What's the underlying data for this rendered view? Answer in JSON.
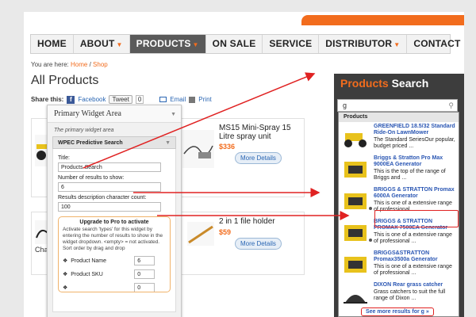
{
  "nav": {
    "items": [
      {
        "label": "HOME",
        "caret": false,
        "active": false
      },
      {
        "label": "ABOUT",
        "caret": true,
        "active": false
      },
      {
        "label": "PRODUCTS",
        "caret": true,
        "active": true
      },
      {
        "label": "ON SALE",
        "caret": false,
        "active": false
      },
      {
        "label": "SERVICE",
        "caret": false,
        "active": false
      },
      {
        "label": "DISTRIBUTOR",
        "caret": true,
        "active": false
      },
      {
        "label": "CONTACT",
        "caret": false,
        "active": false
      }
    ]
  },
  "breadcrumb": {
    "prefix": "You are here:",
    "home": "Home",
    "sep": "/",
    "current": "Shop"
  },
  "page_title": "All Products",
  "share": {
    "label": "Share this:",
    "facebook": "Facebook",
    "tweet": "Tweet",
    "tweet_count": "0",
    "email": "Email",
    "print": "Print"
  },
  "products": [
    {
      "name": "MS15 Mini-Spray 15 Litre spray unit",
      "price": "$336",
      "more": "More Details"
    },
    {
      "name": "2 in 1 file holder",
      "price": "$59",
      "more": "More Details"
    }
  ],
  "clipped_product_label": "Cha",
  "widget": {
    "area_title": "Primary Widget Area",
    "area_desc": "The primary widget area",
    "name": "WPEC Predictive Search",
    "title_label": "Title:",
    "title_value": "Products Search",
    "results_label": "Number of results to show:",
    "results_value": "6",
    "desc_label": "Results description character count:",
    "desc_value": "100",
    "upgrade_title": "Upgrade to Pro to activate",
    "upgrade_desc": "Activate search 'types' for this widget by entering the number of results to show in the widget dropdown. <empty> = not activated. Sort order by drag and drop",
    "options": [
      {
        "name": "Product Name",
        "value": "6"
      },
      {
        "name": "Product SKU",
        "value": "0"
      },
      {
        "name": "",
        "value": "0"
      }
    ]
  },
  "sidebar": {
    "title_orange": "Products",
    "title_white": "Search",
    "search_value": "g",
    "dropdown_header": "Products",
    "results": [
      {
        "name": "GREENFIELD 18.5/32 Standard Ride-On LawnMower",
        "desc": "The Standard SeriesOur popular, budget priced ..."
      },
      {
        "name": "Briggs & Stratton Pro Max 9000EA Generator",
        "desc": "This is the top of the range of Briggs and ..."
      },
      {
        "name": "BRIGGS & STRATTON Promax 6000A Generator",
        "desc": "This is one of a extensive range of professional ..."
      },
      {
        "name": "BRIGGS & STRATTON PROMAX 7500EA Generator",
        "desc": "This is one of a extensive range of professional ..."
      },
      {
        "name": "BRIGGS&STRATTON Promax3500a Generator",
        "desc": "This is one of a extensive range of professional ..."
      },
      {
        "name": "DIXON Rear grass catcher",
        "desc": "Grass catchers to suit the full range of Dixon ..."
      }
    ],
    "see_more": "See more results for g »"
  },
  "colors": {
    "accent": "#f26c1d",
    "arrow": "#e02222",
    "nav_active": "#5a5a5a",
    "sidebar_bg": "#3d3d3d",
    "link": "#2a56b3"
  }
}
